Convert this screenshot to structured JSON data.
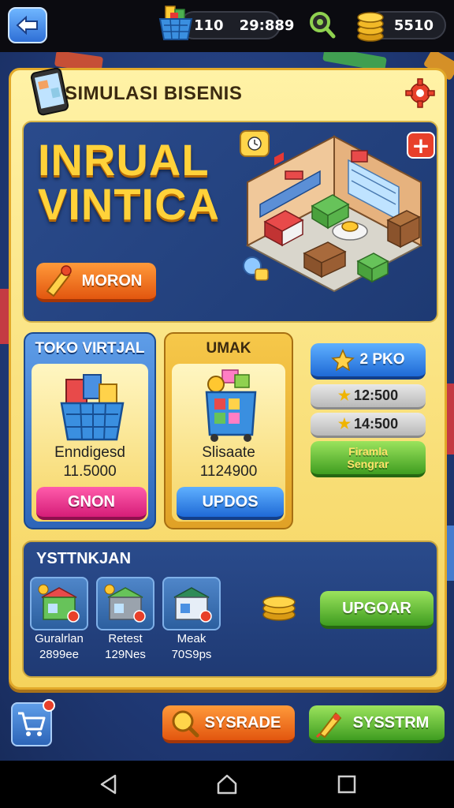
{
  "topbar": {
    "stat_value": "110",
    "timer": "29:889",
    "coins": "5510",
    "icons": [
      "back-arrow-icon",
      "shopping-basket-icon",
      "magnifier-icon",
      "coin-stack-icon"
    ]
  },
  "panel": {
    "title": "SIMULASI BISENIS",
    "hero_line1": "INRUAL",
    "hero_line2": "VINTICA",
    "hero_button": "MORON"
  },
  "stores": [
    {
      "header": "TOKO VIRTJAL",
      "name": "Enndigesd",
      "price": "11.5000",
      "button": "GNON"
    },
    {
      "header": "UMAK",
      "name": "Slisaate",
      "price": "1124900",
      "button": "UPDOS"
    }
  ],
  "side_buttons": {
    "top": "2 PKO",
    "stat1": "12:500",
    "stat2": "14:500",
    "green_line1": "Firamla",
    "green_line2": "Sengrar"
  },
  "inventory": {
    "title": "YSTTNKJAN",
    "items": [
      {
        "name": "Guralrlan",
        "value": "2899ee"
      },
      {
        "name": "Retest",
        "value": "129Nes"
      },
      {
        "name": "Meak",
        "value": "70S9ps"
      }
    ],
    "upgrade_button": "UPGOAR"
  },
  "footer": {
    "left_button": "SYSRADE",
    "right_button": "SYSSTRM"
  },
  "colors": {
    "panel_yellow": "#f5d35c",
    "hero_blue": "#1e3a73",
    "title_gold": "#ffd23a",
    "orange": "#e2560f",
    "green": "#3f9d20",
    "blue": "#1f6ad6",
    "pink": "#d51d78"
  }
}
